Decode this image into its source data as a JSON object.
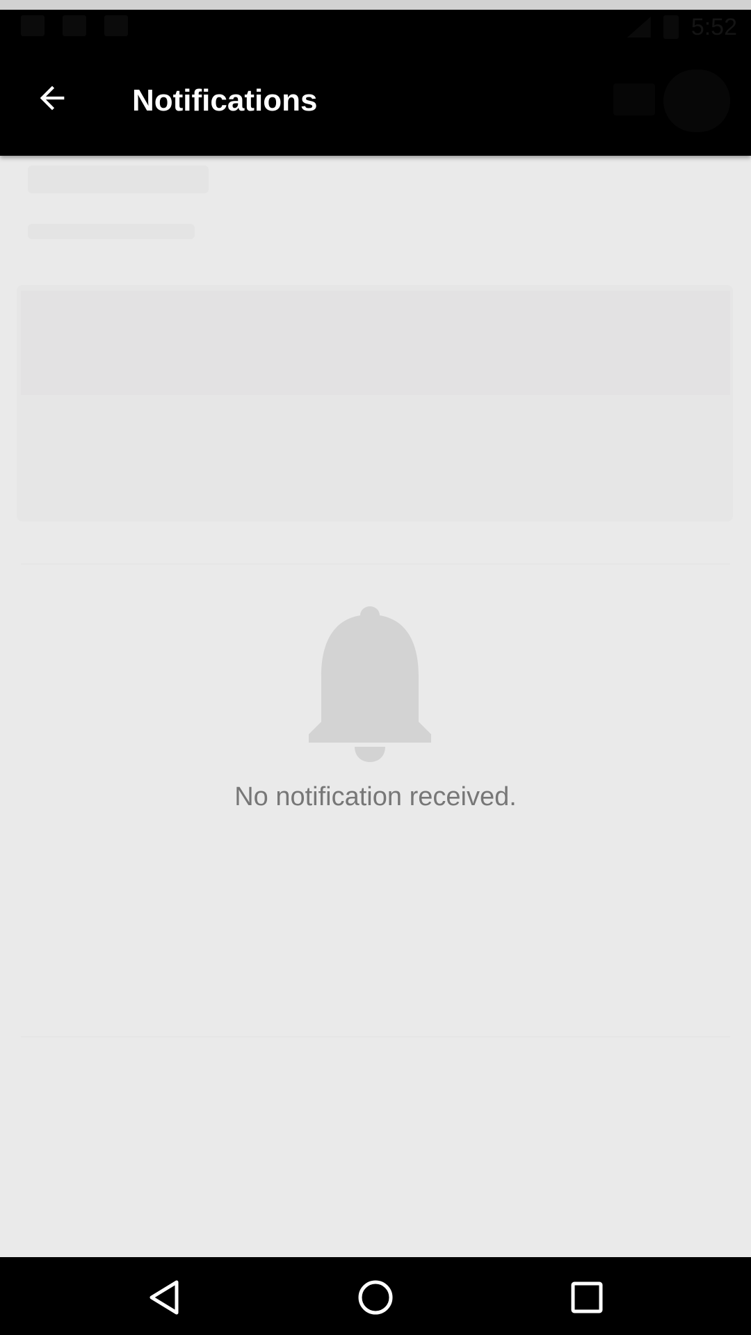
{
  "status_bar": {
    "time": "5:52"
  },
  "app_bar": {
    "title": "Notifications",
    "back_icon": "arrow-back-icon"
  },
  "empty_state": {
    "icon": "bell-icon",
    "message": "No notification received."
  },
  "nav_bar": {
    "back_icon": "triangle-back-icon",
    "home_icon": "circle-home-icon",
    "recents_icon": "square-recents-icon"
  },
  "colors": {
    "app_bar_bg": "#000000",
    "content_bg": "#eaeaea",
    "bell": "#d3d3d3",
    "empty_text": "#777777"
  }
}
